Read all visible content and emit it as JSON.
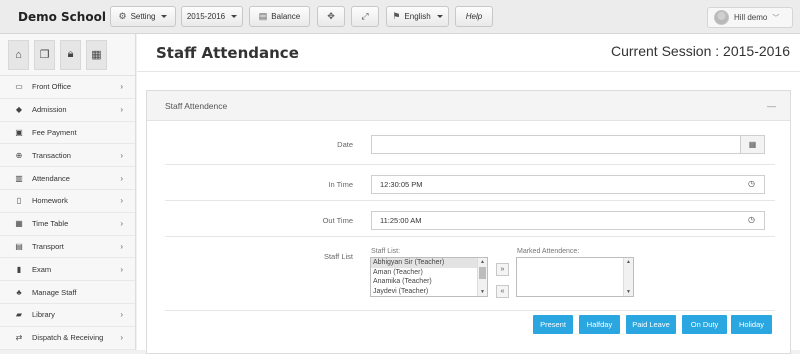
{
  "app": {
    "brand": "Demo School"
  },
  "toolbar": {
    "setting": "Setting",
    "session": "2015-2016",
    "balance": "Balance",
    "language": "English",
    "help": "Help",
    "icons": {
      "setting": "gear-icon",
      "balance": "database-icon",
      "fit": "compress-icon",
      "fullscreen": "expand-icon",
      "language": "flag-icon"
    }
  },
  "user": {
    "name": "Hill demo"
  },
  "sidebar": {
    "quick": [
      "home-icon",
      "documents-icon",
      "lock-icon",
      "calendar-icon"
    ],
    "items": [
      {
        "label": "Front Office",
        "icon": "monitor-icon",
        "has_children": true
      },
      {
        "label": "Admission",
        "icon": "graduation-cap-icon",
        "has_children": true
      },
      {
        "label": "Fee Payment",
        "icon": "money-icon",
        "has_children": false
      },
      {
        "label": "Transaction",
        "icon": "globe-icon",
        "has_children": true
      },
      {
        "label": "Attendance",
        "icon": "bar-chart-icon",
        "has_children": true
      },
      {
        "label": "Homework",
        "icon": "book-icon",
        "has_children": true
      },
      {
        "label": "Time Table",
        "icon": "calendar-icon",
        "has_children": true
      },
      {
        "label": "Transport",
        "icon": "bus-icon",
        "has_children": true
      },
      {
        "label": "Exam",
        "icon": "file-icon",
        "has_children": true
      },
      {
        "label": "Manage Staff",
        "icon": "users-icon",
        "has_children": false
      },
      {
        "label": "Library",
        "icon": "book-icon",
        "has_children": true
      },
      {
        "label": "Dispatch & Receiving",
        "icon": "exchange-icon",
        "has_children": true
      }
    ]
  },
  "page": {
    "title": "Staff Attendance",
    "session": "Current Session : 2015-2016"
  },
  "panel": {
    "title": "Staff Attendence",
    "date_label": "Date",
    "date_value": "",
    "in_time_label": "In Time",
    "in_time_value": "12:30:05 PM",
    "out_time_label": "Out Time",
    "out_time_value": "11:25:00 AM",
    "staff_list_label": "Staff List",
    "staff_list_title": "Staff List:",
    "staff": [
      "Abhigyan Sir (Teacher)",
      "Aman (Teacher)",
      "Anamika (Teacher)",
      "Jaydevi (Teacher)"
    ],
    "marked_title": "Marked Attendence:",
    "marked": []
  },
  "actions": {
    "present": "Present",
    "halfday": "Halfday",
    "paid_leave": "Paid Leave",
    "on_duty": "On Duty",
    "holiday": "Holiday"
  },
  "colors": {
    "action_button": "#2aa6e0",
    "topbar": "#ececec"
  }
}
